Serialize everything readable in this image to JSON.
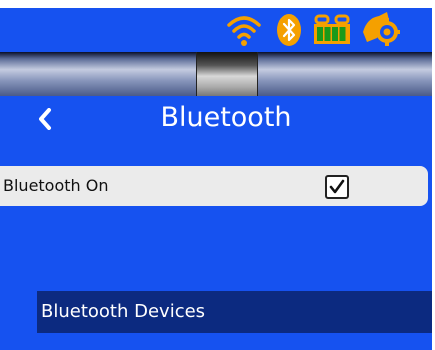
{
  "status_bar": {
    "icons": [
      "wifi-icon",
      "bluetooth-icon",
      "battery-icon",
      "settings-icon"
    ],
    "accent_color": "#f5a000"
  },
  "header": {
    "title": "Bluetooth",
    "back_icon": "chevron-left-icon"
  },
  "bluetooth_toggle": {
    "label": "Bluetooth On",
    "checked": true
  },
  "devices_section": {
    "label": "Bluetooth Devices"
  },
  "colors": {
    "background": "#1652f0",
    "row_background": "#ebebeb",
    "section_background": "#0c2a80"
  }
}
